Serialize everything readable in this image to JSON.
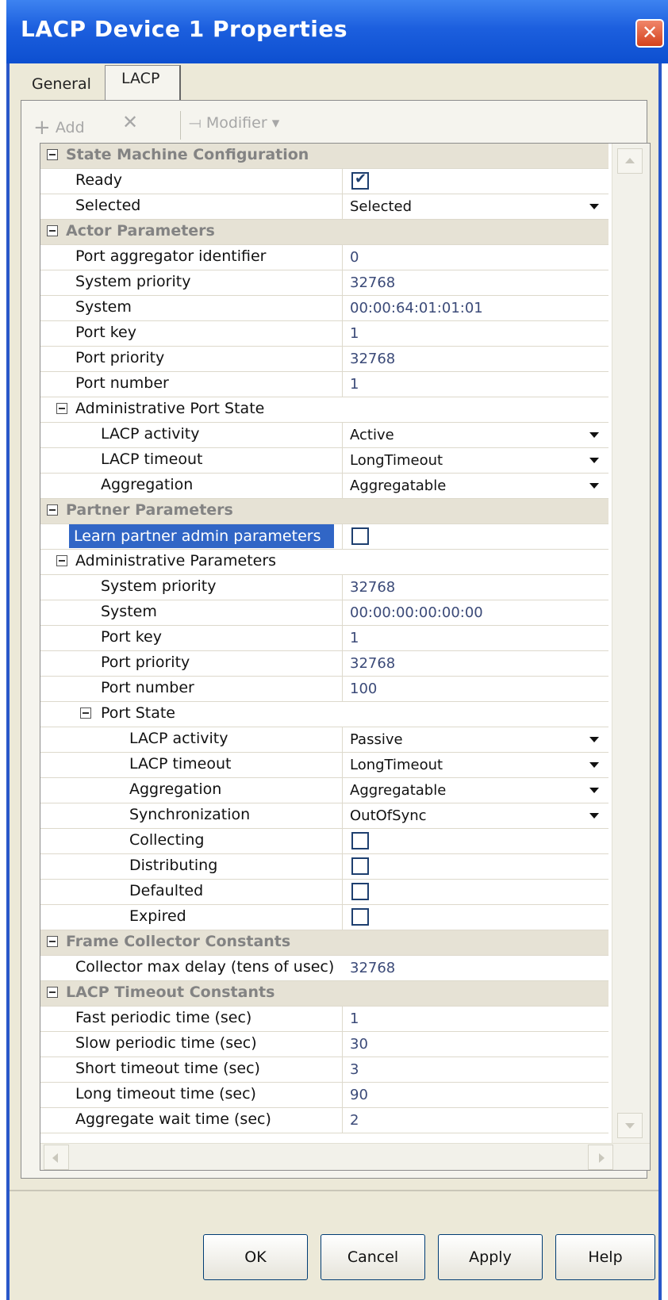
{
  "window": {
    "title": "LACP Device 1 Properties",
    "close_glyph": "✕"
  },
  "tabs": [
    {
      "label": "General"
    },
    {
      "label": "LACP"
    }
  ],
  "toolbar": {
    "add_label": "Add",
    "add_glyph": "+",
    "delete_glyph": "✕",
    "modifier_label": "Modifier",
    "modifier_glyph": "⟞",
    "dropdown_glyph": "▾"
  },
  "sections": {
    "state_machine": {
      "title": "State Machine Configuration",
      "ready": {
        "label": "Ready",
        "checked": true
      },
      "selected": {
        "label": "Selected",
        "value": "Selected"
      }
    },
    "actor": {
      "title": "Actor Parameters",
      "port_aggregator_identifier": {
        "label": "Port aggregator identifier",
        "value": "0"
      },
      "system_priority": {
        "label": "System priority",
        "value": "32768"
      },
      "system": {
        "label": "System",
        "value": "00:00:64:01:01:01"
      },
      "port_key": {
        "label": "Port key",
        "value": "1"
      },
      "port_priority": {
        "label": "Port priority",
        "value": "32768"
      },
      "port_number": {
        "label": "Port number",
        "value": "1"
      },
      "admin_port_state": {
        "title": "Administrative Port State",
        "lacp_activity": {
          "label": "LACP activity",
          "value": "Active"
        },
        "lacp_timeout": {
          "label": "LACP timeout",
          "value": "LongTimeout"
        },
        "aggregation": {
          "label": "Aggregation",
          "value": "Aggregatable"
        }
      }
    },
    "partner": {
      "title": "Partner Parameters",
      "learn": {
        "label": "Learn partner admin parameters",
        "checked": false
      },
      "admin": {
        "title": "Administrative Parameters",
        "system_priority": {
          "label": "System priority",
          "value": "32768"
        },
        "system": {
          "label": "System",
          "value": "00:00:00:00:00:00"
        },
        "port_key": {
          "label": "Port key",
          "value": "1"
        },
        "port_priority": {
          "label": "Port priority",
          "value": "32768"
        },
        "port_number": {
          "label": "Port number",
          "value": "100"
        },
        "port_state": {
          "title": "Port State",
          "lacp_activity": {
            "label": "LACP activity",
            "value": "Passive"
          },
          "lacp_timeout": {
            "label": "LACP timeout",
            "value": "LongTimeout"
          },
          "aggregation": {
            "label": "Aggregation",
            "value": "Aggregatable"
          },
          "synchronization": {
            "label": "Synchronization",
            "value": "OutOfSync"
          },
          "collecting": {
            "label": "Collecting",
            "checked": false
          },
          "distributing": {
            "label": "Distributing",
            "checked": false
          },
          "defaulted": {
            "label": "Defaulted",
            "checked": false
          },
          "expired": {
            "label": "Expired",
            "checked": false
          }
        }
      }
    },
    "frame_collector": {
      "title": "Frame Collector Constants",
      "max_delay": {
        "label": "Collector max delay (tens of usec)",
        "value": "32768"
      }
    },
    "timeout_constants": {
      "title": "LACP Timeout Constants",
      "fast_periodic": {
        "label": "Fast periodic time (sec)",
        "value": "1"
      },
      "slow_periodic": {
        "label": "Slow periodic time (sec)",
        "value": "30"
      },
      "short_timeout": {
        "label": "Short timeout time (sec)",
        "value": "3"
      },
      "long_timeout": {
        "label": "Long timeout time (sec)",
        "value": "90"
      },
      "aggregate_wait": {
        "label": "Aggregate wait time (sec)",
        "value": "2"
      }
    }
  },
  "buttons": {
    "ok": "OK",
    "cancel": "Cancel",
    "apply": "Apply",
    "help": "Help"
  }
}
